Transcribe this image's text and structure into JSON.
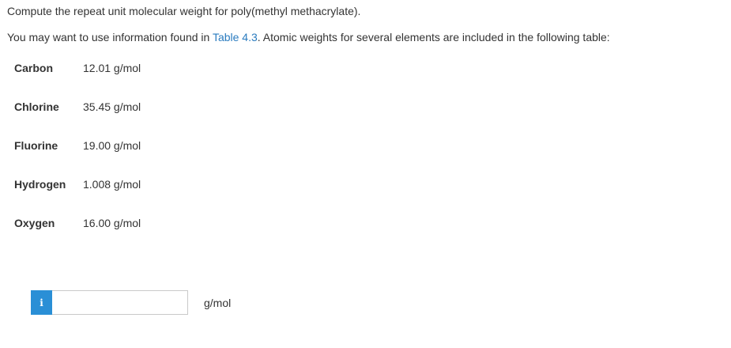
{
  "question": "Compute the repeat unit molecular weight for poly(methyl methacrylate).",
  "info": {
    "prefix": "You may want to use information found in ",
    "link": "Table 4.3",
    "suffix": ". Atomic weights for several elements are included in the following table:"
  },
  "elements": [
    {
      "name": "Carbon",
      "weight": "12.01 g/mol"
    },
    {
      "name": "Chlorine",
      "weight": "35.45 g/mol"
    },
    {
      "name": "Fluorine",
      "weight": "19.00 g/mol"
    },
    {
      "name": "Hydrogen",
      "weight": "1.008 g/mol"
    },
    {
      "name": "Oxygen",
      "weight": "16.00 g/mol"
    }
  ],
  "answer": {
    "badge_icon": "info-icon",
    "badge_glyph": "i",
    "value": "",
    "unit": "g/mol"
  },
  "colors": {
    "link": "#2a7bbf",
    "badge": "#2a8fd6"
  }
}
